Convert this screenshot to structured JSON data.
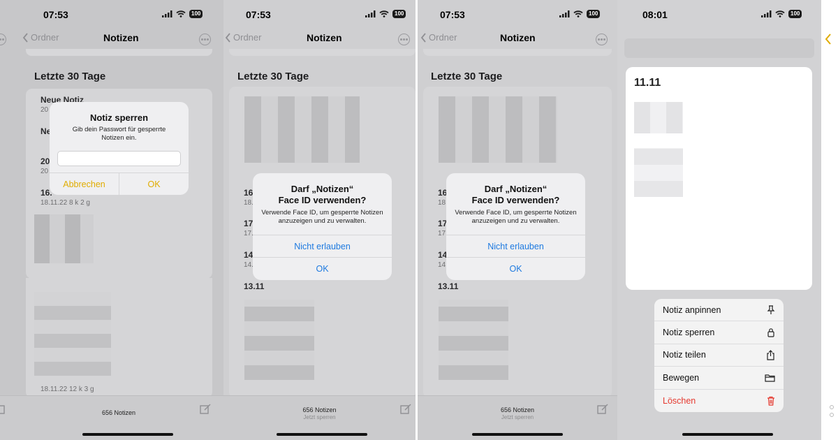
{
  "screens": [
    {
      "status": {
        "time": "07:53",
        "battery": "100"
      },
      "nav": {
        "back_label": "Ordner",
        "title": "Notizen"
      },
      "section_title": "Letzte 30 Tage",
      "rows": [
        {
          "title": "Neue Notiz",
          "subtitle": "20"
        },
        {
          "title": "Ne",
          "subtitle": ""
        },
        {
          "title": "20",
          "subtitle": "20"
        },
        {
          "title": "16.",
          "subtitle": "18.11.22  8 k 2 g"
        }
      ],
      "footer": {
        "count": "656 Notizen",
        "date_partial": "18.11.22  12 k 3 g"
      },
      "alert": {
        "title": "Notiz sperren",
        "message": "Gib dein Passwort für gesperrte Notizen ein.",
        "password_placeholder": "",
        "cancel": "Abbrechen",
        "ok": "OK",
        "accent": "#e0ac00"
      }
    },
    {
      "status": {
        "time": "07:53",
        "battery": "100"
      },
      "nav": {
        "back_label": "Ordner",
        "title": "Notizen"
      },
      "section_title": "Letzte 30 Tage",
      "rows": [
        {
          "title": "16",
          "subtitle": "18."
        },
        {
          "title": "17",
          "subtitle": "17."
        },
        {
          "title": "14",
          "subtitle": "14."
        },
        {
          "title": "13.11",
          "subtitle": ""
        }
      ],
      "footer": {
        "count": "656 Notizen",
        "lock": "Jetzt sperren"
      },
      "alert": {
        "title_line1": "Darf „Notizen“",
        "title_line2": "Face ID verwenden?",
        "message": "Verwende Face ID, um gesperrte Notizen anzuzeigen und zu verwalten.",
        "deny": "Nicht erlauben",
        "ok": "OK",
        "accent": "#1e7ae0"
      }
    },
    {
      "status": {
        "time": "07:53",
        "battery": "100"
      },
      "nav": {
        "back_label": "Ordner",
        "title": "Notizen"
      },
      "section_title": "Letzte 30 Tage",
      "rows": [
        {
          "title": "16",
          "subtitle": "18."
        },
        {
          "title": "17",
          "subtitle": "17."
        },
        {
          "title": "14",
          "subtitle": "14."
        },
        {
          "title": "13.11",
          "subtitle": ""
        }
      ],
      "footer": {
        "count": "656 Notizen",
        "lock": "Jetzt sperren"
      },
      "alert": {
        "title_line1": "Darf „Notizen“",
        "title_line2": "Face ID verwenden?",
        "message": "Verwende Face ID, um gesperrte Notizen anzuzeigen und zu verwalten.",
        "deny": "Nicht erlauben",
        "ok": "OK",
        "accent": "#1e7ae0"
      }
    },
    {
      "status": {
        "time": "08:01",
        "battery": "100"
      },
      "preview_title": "11.11",
      "menu": [
        {
          "label": "Notiz anpinnen",
          "icon": "pin-icon"
        },
        {
          "label": "Notiz sperren",
          "icon": "lock-icon"
        },
        {
          "label": "Notiz teilen",
          "icon": "share-icon"
        },
        {
          "label": "Bewegen",
          "icon": "folder-icon"
        },
        {
          "label": "Löschen",
          "icon": "trash-icon",
          "destructive": true
        }
      ]
    }
  ]
}
